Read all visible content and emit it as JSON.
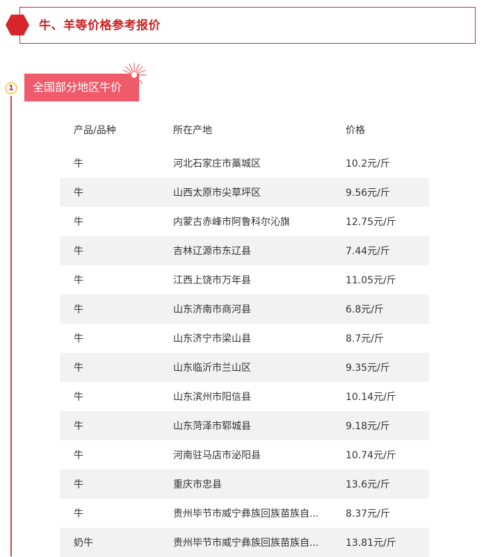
{
  "header": {
    "title": "牛、羊等价格参考报价",
    "accent_color": "#d6262c"
  },
  "section": {
    "number": "1",
    "label": "全国部分地区牛价",
    "label_color": "#ef5b6b"
  },
  "table": {
    "columns": [
      "产品/品种",
      "所在产地",
      "价格"
    ],
    "rows": [
      {
        "product": "牛",
        "origin": "河北石家庄市藁城区",
        "price": "10.2元/斤"
      },
      {
        "product": "牛",
        "origin": "山西太原市尖草坪区",
        "price": "9.56元/斤"
      },
      {
        "product": "牛",
        "origin": "内蒙古赤峰市阿鲁科尔沁旗",
        "price": "12.75元/斤"
      },
      {
        "product": "牛",
        "origin": "吉林辽源市东辽县",
        "price": "7.44元/斤"
      },
      {
        "product": "牛",
        "origin": "江西上饶市万年县",
        "price": "11.05元/斤"
      },
      {
        "product": "牛",
        "origin": "山东济南市商河县",
        "price": "6.8元/斤"
      },
      {
        "product": "牛",
        "origin": "山东济宁市梁山县",
        "price": "8.7元/斤"
      },
      {
        "product": "牛",
        "origin": "山东临沂市兰山区",
        "price": "9.35元/斤"
      },
      {
        "product": "牛",
        "origin": "山东滨州市阳信县",
        "price": "10.14元/斤"
      },
      {
        "product": "牛",
        "origin": "山东菏泽市郓城县",
        "price": "9.18元/斤"
      },
      {
        "product": "牛",
        "origin": "河南驻马店市泌阳县",
        "price": "10.74元/斤"
      },
      {
        "product": "牛",
        "origin": "重庆市忠县",
        "price": "13.6元/斤"
      },
      {
        "product": "牛",
        "origin": "贵州毕节市威宁彝族回族苗族自...",
        "price": "8.37元/斤"
      },
      {
        "product": "奶牛",
        "origin": "贵州毕节市威宁彝族回族苗族自...",
        "price": "13.81元/斤"
      }
    ]
  },
  "icons": {
    "header_marker": "hexagon-icon",
    "decoration": "firework-icon"
  }
}
